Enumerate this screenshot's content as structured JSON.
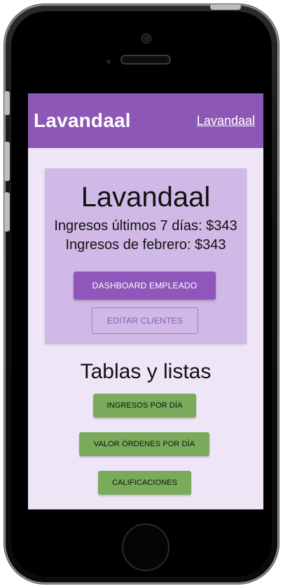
{
  "app": {
    "brand": "Lavandaal",
    "top_link": "Lavandaal"
  },
  "summary": {
    "title": "Lavandaal",
    "income_last_7_days": "Ingresos últimos 7 días: $343",
    "income_february": "Ingresos de febrero: $343",
    "primary_button": "DASHBOARD EMPLEADO",
    "secondary_button": "EDITAR CLIENTES"
  },
  "tables": {
    "title": "Tablas y listas",
    "buttons": [
      "INGRESOS POR DÍA",
      "VALOR ÓRDENES POR DÍA",
      "CALIFICACIONES"
    ]
  },
  "colors": {
    "topbar": "#8d58b5",
    "screen_bg": "#eee6f6",
    "card_bg": "#d0b9e6",
    "primary": "#8f57ba",
    "secondary_border": "#a27cc6",
    "green": "#79ab5b"
  }
}
